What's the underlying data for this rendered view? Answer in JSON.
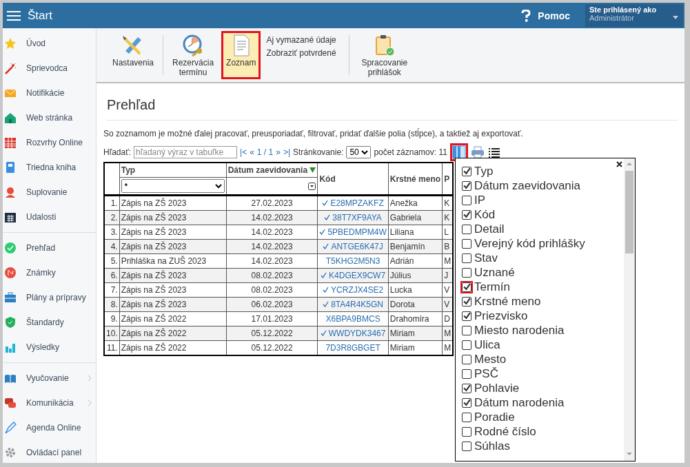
{
  "top_bar": {
    "title": "Štart",
    "help": "Pomoc",
    "user_caption": "Ste prihlásený ako",
    "user_name": "Administrátor"
  },
  "sidebar": {
    "groups": [
      [
        {
          "label": "Úvod",
          "has_submenu": false
        },
        {
          "label": "Sprievodca",
          "has_submenu": false
        },
        {
          "label": "Notifikácie",
          "has_submenu": false
        },
        {
          "label": "Web stránka",
          "has_submenu": false
        },
        {
          "label": "Rozvrhy Online",
          "has_submenu": false
        },
        {
          "label": "Triedna kniha",
          "has_submenu": false
        },
        {
          "label": "Suplovanie",
          "has_submenu": false
        },
        {
          "label": "Udalosti",
          "has_submenu": false
        }
      ],
      [
        {
          "label": "Prehľad",
          "has_submenu": false
        },
        {
          "label": "Známky",
          "has_submenu": false
        },
        {
          "label": "Plány a prípravy",
          "has_submenu": false
        },
        {
          "label": "Štandardy",
          "has_submenu": false
        },
        {
          "label": "Výsledky",
          "has_submenu": false
        }
      ],
      [
        {
          "label": "Vyučovanie",
          "has_submenu": true
        },
        {
          "label": "Komunikácia",
          "has_submenu": true
        },
        {
          "label": "Agenda Online",
          "has_submenu": false
        },
        {
          "label": "Ovládací panel",
          "has_submenu": false
        }
      ]
    ]
  },
  "toolbar": {
    "buttons": [
      {
        "label": "Nastavenia",
        "selected": false,
        "highlighted": false
      },
      {
        "label": "Rezervácia termínu",
        "selected": false,
        "highlighted": false
      },
      {
        "label": "Zoznam",
        "selected": true,
        "highlighted": true
      }
    ],
    "links": [
      "Aj vymazané údaje",
      "Zobraziť potvrdené"
    ],
    "extra_button": {
      "label": "Spracovanie prihlášok"
    }
  },
  "page": {
    "title": "Prehľad",
    "description": "So zoznamom je možné ďalej pracovať, preusporiadať, filtrovať, pridať ďalšie polia (stĺpce), a taktiež aj exportovať.",
    "search_label": "Hľadať:",
    "search_placeholder": "hľadaný výraz v tabuľke",
    "pager": [
      "|<",
      "«",
      "1 / 1",
      "»",
      ">|"
    ],
    "paging_label": "Stránkovanie:",
    "page_size": "50",
    "record_count": "počet záznamov: 11",
    "columns_button_highlighted": true
  },
  "table": {
    "columns": [
      "Typ",
      "Dátum zaevidovania",
      "Kód",
      "Krstné meno",
      "P"
    ],
    "type_filter": "*",
    "rows": [
      {
        "num": "1.",
        "type": "Zápis na ZŠ 2023",
        "date": "27.02.2023",
        "code": "E28MPZAKFZ",
        "confirmed": true,
        "first_name": "Anežka",
        "column_5": "K"
      },
      {
        "num": "2.",
        "type": "Zápis na ZŠ 2023",
        "date": "14.02.2023",
        "code": "38T7XF9AYA",
        "confirmed": true,
        "first_name": "Gabriela",
        "column_5": "K"
      },
      {
        "num": "3.",
        "type": "Zápis na ZŠ 2023",
        "date": "14.02.2023",
        "code": "5PBEDMPM4W",
        "confirmed": true,
        "first_name": "Liliana",
        "column_5": "L"
      },
      {
        "num": "4.",
        "type": "Zápis na ZŠ 2023",
        "date": "14.02.2023",
        "code": "ANTGE6K47J",
        "confirmed": true,
        "first_name": "Benjamín",
        "column_5": "B"
      },
      {
        "num": "5.",
        "type": "Prihláška na ZUŠ 2023",
        "date": "14.02.2023",
        "code": "T5KHG2M5N3",
        "confirmed": false,
        "first_name": "Adrián",
        "column_5": "M"
      },
      {
        "num": "6.",
        "type": "Zápis na ZŠ 2023",
        "date": "08.02.2023",
        "code": "K4DGEX9CW7",
        "confirmed": true,
        "first_name": "Július",
        "column_5": "J"
      },
      {
        "num": "7.",
        "type": "Zápis na ZŠ 2023",
        "date": "08.02.2023",
        "code": "YCRZJX4SE2",
        "confirmed": true,
        "first_name": "Lucka",
        "column_5": "V"
      },
      {
        "num": "8.",
        "type": "Zápis na ZŠ 2023",
        "date": "06.02.2023",
        "code": "8TA4R4K5GN",
        "confirmed": true,
        "first_name": "Dorota",
        "column_5": "V"
      },
      {
        "num": "9.",
        "type": "Zápis na ZŠ 2022",
        "date": "17.01.2023",
        "code": "X6BPA9BMCS",
        "confirmed": false,
        "first_name": "Drahomíra",
        "column_5": "D"
      },
      {
        "num": "10.",
        "type": "Zápis na ZŠ 2022",
        "date": "05.12.2022",
        "code": "WWDYDK3467",
        "confirmed": true,
        "first_name": "Miriam",
        "column_5": "M"
      },
      {
        "num": "11.",
        "type": "Zápis na ZŠ 2022",
        "date": "05.12.2022",
        "code": "7D3R8GBGET",
        "confirmed": false,
        "first_name": "Miriam",
        "column_5": "M"
      }
    ]
  },
  "column_picker": {
    "items": [
      {
        "label": "Typ",
        "checked": true,
        "highlighted": false
      },
      {
        "label": "Dátum zaevidovania",
        "checked": true,
        "highlighted": false
      },
      {
        "label": "IP",
        "checked": false,
        "highlighted": false
      },
      {
        "label": "Kód",
        "checked": true,
        "highlighted": false
      },
      {
        "label": "Detail",
        "checked": false,
        "highlighted": false
      },
      {
        "label": "Verejný kód prihlášky",
        "checked": false,
        "highlighted": false
      },
      {
        "label": "Stav",
        "checked": false,
        "highlighted": false
      },
      {
        "label": "Uznané",
        "checked": false,
        "highlighted": false
      },
      {
        "label": "Termín",
        "checked": true,
        "highlighted": true
      },
      {
        "label": "Krstné meno",
        "checked": true,
        "highlighted": false
      },
      {
        "label": "Priezvisko",
        "checked": true,
        "highlighted": false
      },
      {
        "label": "Miesto narodenia",
        "checked": false,
        "highlighted": false
      },
      {
        "label": "Ulica",
        "checked": false,
        "highlighted": false
      },
      {
        "label": "Mesto",
        "checked": false,
        "highlighted": false
      },
      {
        "label": "PSČ",
        "checked": false,
        "highlighted": false
      },
      {
        "label": "Pohlavie",
        "checked": true,
        "highlighted": false
      },
      {
        "label": "Dátum narodenia",
        "checked": true,
        "highlighted": false
      },
      {
        "label": "Poradie",
        "checked": false,
        "highlighted": false
      },
      {
        "label": "Rodné číslo",
        "checked": false,
        "highlighted": false
      },
      {
        "label": "Súhlas",
        "checked": false,
        "highlighted": false
      }
    ]
  }
}
